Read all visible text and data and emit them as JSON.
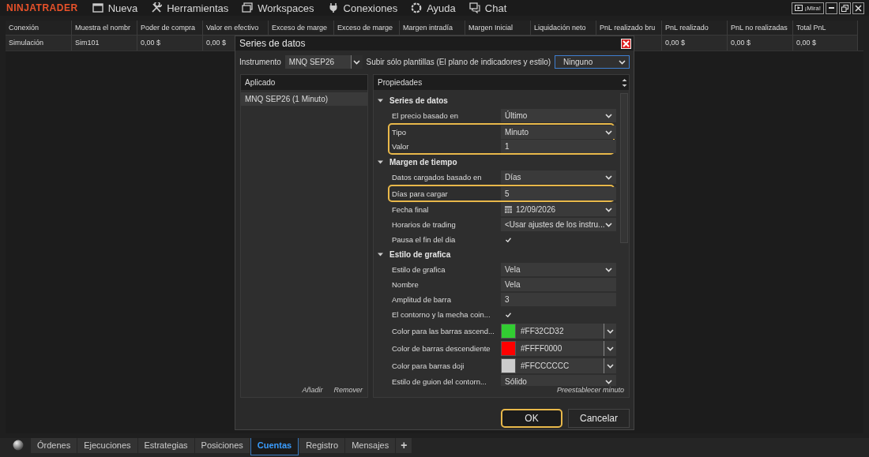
{
  "app": {
    "logo": "NINJATRADER",
    "menu": [
      {
        "label": "Nueva"
      },
      {
        "label": "Herramientas"
      },
      {
        "label": "Workspaces"
      },
      {
        "label": "Conexiones"
      },
      {
        "label": "Ayuda"
      },
      {
        "label": "Chat"
      }
    ],
    "mira_button": "¡Mira!"
  },
  "accounts_table": {
    "columns": [
      "Conexión",
      "Muestra el nombr",
      "Poder de compra",
      "Valor en efectivo",
      "Exceso de marge",
      "Exceso de marge",
      "Margen intradía",
      "Margen Inicial",
      "Liquidación neto",
      "PnL realizado bru",
      "PnL realizado",
      "PnL no realizadas",
      "Total PnL"
    ],
    "rows": [
      {
        "cells": [
          "Simulación",
          "Sim101",
          "0,00 $",
          "0,00 $",
          null,
          null,
          null,
          null,
          null,
          null,
          "0,00 $",
          "0,00 $",
          "0,00 $"
        ]
      }
    ]
  },
  "dialog": {
    "title": "Series de datos",
    "instrument_label": "Instrumento",
    "instrument": "MNQ SEP26",
    "template_label": "Subir sólo plantillas (El plano de indicadores y estilo)",
    "template": "Ninguno",
    "applied": {
      "header": "Aplicado",
      "items": [
        {
          "label": "MNQ SEP26 (1 Minuto)",
          "selected": true
        }
      ],
      "actions": [
        "Añadir",
        "Remover"
      ]
    },
    "properties": {
      "header": "Propiedades",
      "categories": [
        {
          "label": "Series de datos",
          "expanded": true,
          "items": [
            {
              "label": "El precio basado en",
              "kind": "dropdown",
              "value": "Último",
              "highlighted": false
            },
            {
              "label": "Tipo",
              "kind": "dropdown",
              "value": "Minuto",
              "highlighted": true
            },
            {
              "label": "Valor",
              "kind": "text",
              "value": "1",
              "highlighted": true
            }
          ]
        },
        {
          "label": "Margen de tiempo",
          "expanded": true,
          "items": [
            {
              "label": "Datos cargados basado en",
              "kind": "dropdown",
              "value": "Días",
              "highlighted": false
            },
            {
              "label": "Días para cargar",
              "kind": "text",
              "value": "5",
              "highlighted": true
            },
            {
              "label": "Fecha final",
              "kind": "date",
              "value": "12/09/2026",
              "highlighted": false
            },
            {
              "label": "Horarios de trading",
              "kind": "dropdown",
              "value": "<Usar ajustes de los instru...",
              "highlighted": false
            },
            {
              "label": "Pausa el fin del dia",
              "kind": "checkbox",
              "checked": true,
              "highlighted": false
            }
          ]
        },
        {
          "label": "Estilo de grafica",
          "expanded": true,
          "items": [
            {
              "label": "Estilo de grafica",
              "kind": "dropdown",
              "value": "Vela",
              "highlighted": false
            },
            {
              "label": "Nombre",
              "kind": "text",
              "value": "Vela",
              "highlighted": false
            },
            {
              "label": "Amplitud de barra",
              "kind": "text",
              "value": "3",
              "highlighted": false
            },
            {
              "label": "El contorno y la mecha coin...",
              "kind": "checkbox",
              "checked": true,
              "highlighted": false
            },
            {
              "label": "Color para las barras ascend...",
              "kind": "color",
              "color": "#32cd32",
              "value": "#FF32CD32",
              "highlighted": false
            },
            {
              "label": "Color de barras descendiente",
              "kind": "color",
              "color": "#ff0000",
              "value": "#FFFF0000",
              "highlighted": false
            },
            {
              "label": "Color para barras doji",
              "kind": "color",
              "color": "#cccccc",
              "value": "#FFCCCCCC",
              "highlighted": false
            },
            {
              "label": "Estilo de guion del contorn...",
              "kind": "dropdown",
              "value": "Sólido",
              "highlighted": false
            }
          ]
        }
      ],
      "footer": "Preestablecer minuto"
    },
    "buttons": [
      {
        "label": "OK",
        "highlighted": true
      },
      {
        "label": "Cancelar",
        "highlighted": false
      }
    ]
  },
  "bottom_tabs": [
    {
      "label": "Órdenes",
      "selected": false
    },
    {
      "label": "Ejecuciones",
      "selected": false
    },
    {
      "label": "Estrategias",
      "selected": false
    },
    {
      "label": "Posiciones",
      "selected": false
    },
    {
      "label": "Cuentas",
      "selected": true
    },
    {
      "label": "Registro",
      "selected": false
    },
    {
      "label": "Mensajes",
      "selected": false
    }
  ],
  "add_tab": "+"
}
